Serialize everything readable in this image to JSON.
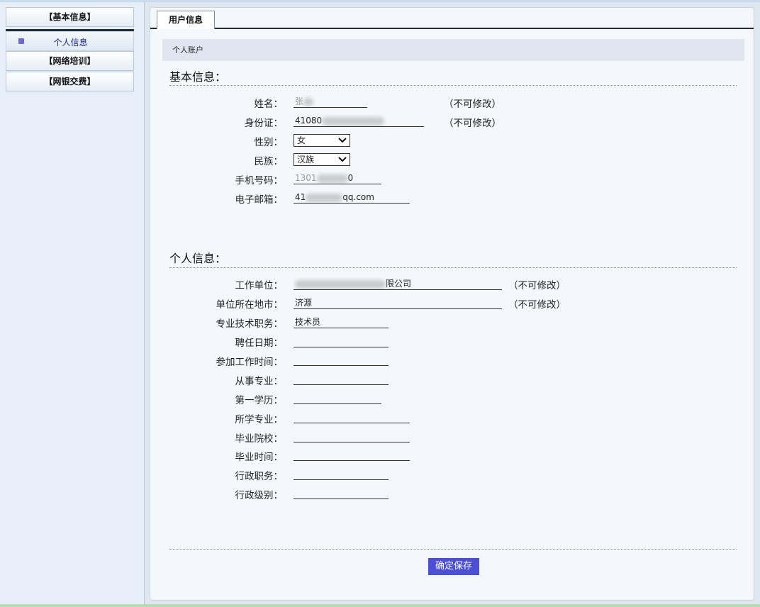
{
  "sidebar": {
    "basic_info": "【基本信息】",
    "personal_info": "个人信息",
    "online_training": "【网络培训】",
    "online_payment": "【网银交费】"
  },
  "tab": {
    "label": "用户信息"
  },
  "section_title": "个人账户",
  "basic": {
    "title": "基本信息：",
    "name_label": "姓名：",
    "name_value": "张",
    "name_note": "（不可修改）",
    "id_label": "身份证：",
    "id_value": "41080",
    "id_note": "（不可修改）",
    "gender_label": "性别：",
    "gender_value": "女",
    "ethnicity_label": "民族：",
    "ethnicity_value": "汉族",
    "phone_label": "手机号码：",
    "phone_value": "1301",
    "phone_value_tail": "0",
    "email_label": "电子邮箱：",
    "email_value": "41",
    "email_value_tail": "qq.com"
  },
  "personal": {
    "title": "个人信息：",
    "employer_label": "工作单位：",
    "employer_value": "限公司",
    "employer_note": "（不可修改）",
    "city_label": "单位所在地市：",
    "city_value": "济源",
    "city_note": "（不可修改）",
    "title_post_label": "专业技术职务：",
    "title_post_value": "技术员",
    "appoint_date_label": "聘任日期：",
    "work_start_label": "参加工作时间：",
    "major_engaged_label": "从事专业：",
    "first_degree_label": "第一学历：",
    "major_studied_label": "所学专业：",
    "school_label": "毕业院校：",
    "grad_time_label": "毕业时间：",
    "admin_post_label": "行政职务：",
    "admin_level_label": "行政级别："
  },
  "actions": {
    "save_label": "确定保存"
  },
  "colors": {
    "save_button": "#4a4fd6",
    "tab_rule": "#1f2a3a",
    "section_bar": "#dfe6ef"
  }
}
